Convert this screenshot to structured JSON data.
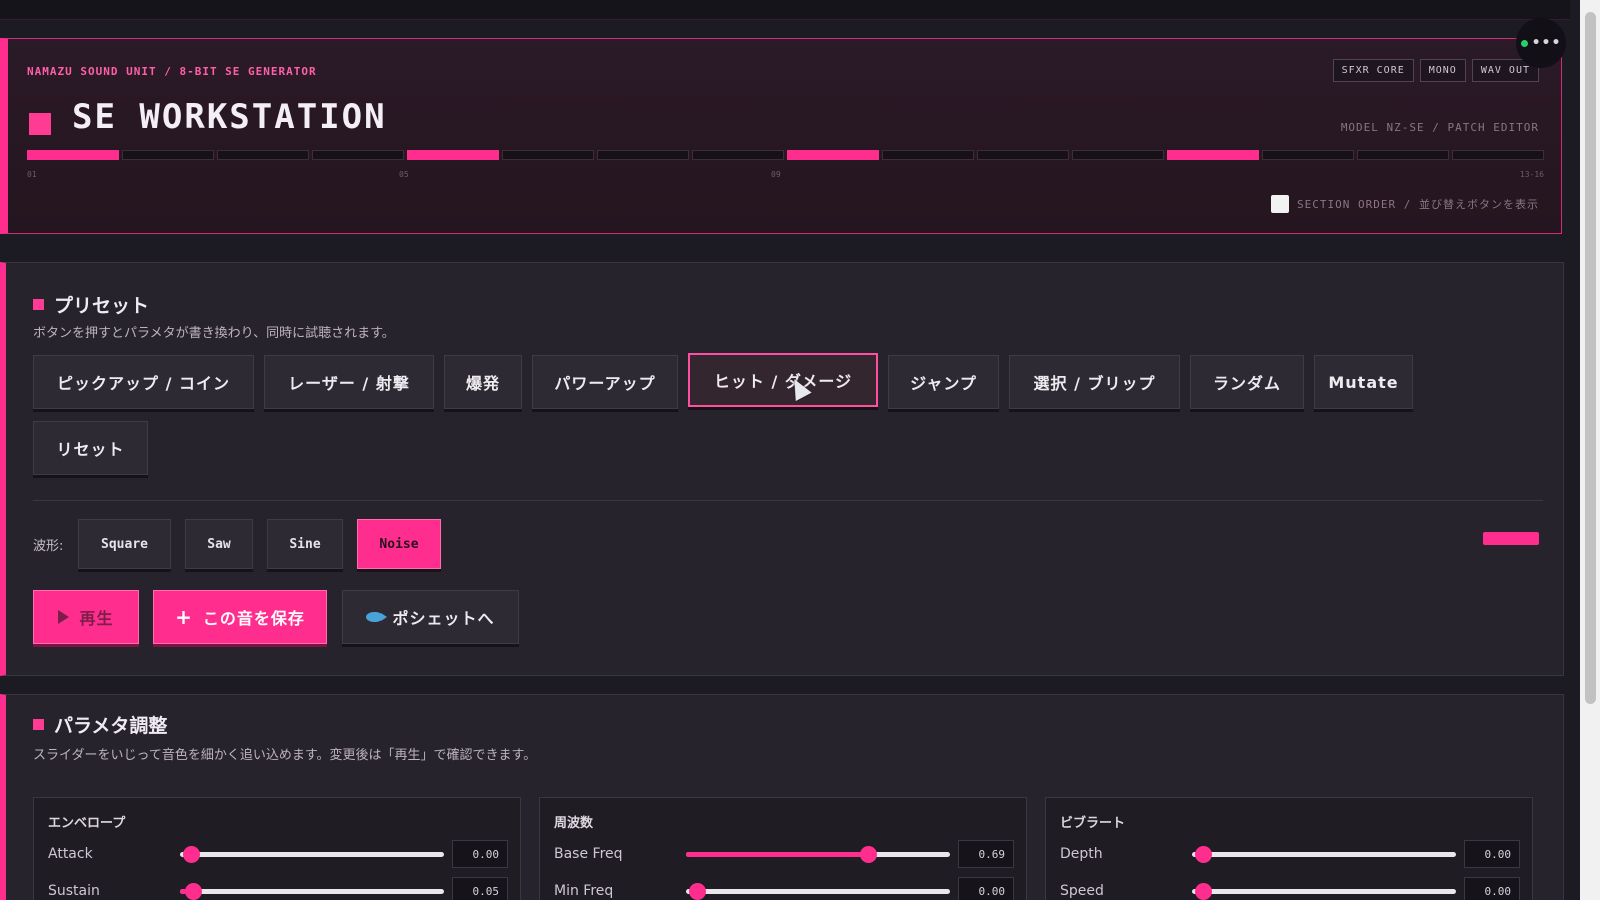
{
  "header": {
    "brand": "NAMAZU SOUND UNIT / 8-BIT SE GENERATOR",
    "title": "SE WORKSTATION",
    "badges": [
      "SFXR CORE",
      "MONO",
      "WAV OUT"
    ],
    "model": "MODEL NZ-SE / PATCH EDITOR",
    "steps_active": [
      1,
      5,
      9,
      13
    ],
    "step_count": 16,
    "step_labels": [
      "01",
      "05",
      "09",
      "13-16"
    ],
    "section_order_label": "SECTION ORDER / 並び替えボタンを表示",
    "section_order_checked": false
  },
  "corner": {
    "status_color": "#27d06d",
    "menu_label": "•••"
  },
  "presets": {
    "title": "プリセット",
    "description": "ボタンを押すとパラメタが書き換わり、同時に試聴されます。",
    "buttons": [
      "ピックアップ / コイン",
      "レーザー / 射撃",
      "爆発",
      "パワーアップ",
      "ヒット / ダメージ",
      "ジャンプ",
      "選択 / ブリップ",
      "ランダム",
      "Mutate",
      "リセット"
    ],
    "selected": "ヒット / ダメージ",
    "waveform_label": "波形:",
    "waveforms": [
      "Square",
      "Saw",
      "Sine",
      "Noise"
    ],
    "waveform_selected": "Noise",
    "actions": {
      "play": "再生",
      "save": "この音を保存",
      "pochette": "ポシェットへ"
    }
  },
  "params": {
    "title": "パラメタ調整",
    "description": "スライダーをいじって音色を細かく追い込めます。変更後は「再生」で確認できます。",
    "groups": [
      {
        "title": "エンベロープ",
        "rows": [
          {
            "label": "Attack",
            "value": "0.00",
            "level": 0.0
          },
          {
            "label": "Sustain",
            "value": "0.05",
            "level": 0.05
          }
        ]
      },
      {
        "title": "周波数",
        "rows": [
          {
            "label": "Base Freq",
            "value": "0.69",
            "level": 0.69
          },
          {
            "label": "Min Freq",
            "value": "0.00",
            "level": 0.0
          }
        ]
      },
      {
        "title": "ビブラート",
        "rows": [
          {
            "label": "Depth",
            "value": "0.00",
            "level": 0.0
          },
          {
            "label": "Speed",
            "value": "0.00",
            "level": 0.0
          }
        ]
      }
    ]
  },
  "colors": {
    "accent": "#ff2e8e",
    "background": "#1c1a22",
    "panel": "#27232c"
  }
}
